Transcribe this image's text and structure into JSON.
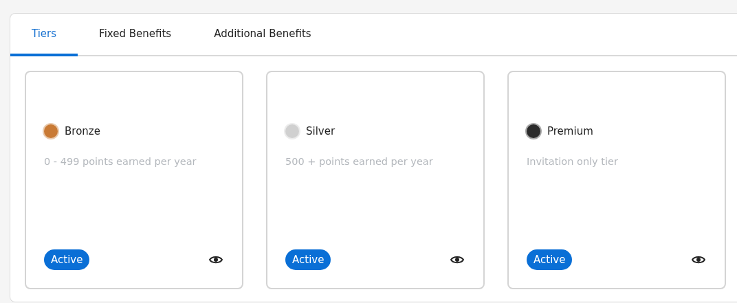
{
  "tabs": [
    {
      "label": "Tiers",
      "selected": true
    },
    {
      "label": "Fixed Benefits",
      "selected": false
    },
    {
      "label": "Additional Benefits",
      "selected": false
    }
  ],
  "tiers": [
    {
      "name": "Bronze",
      "color": "#c97a35",
      "description": "0 - 499 points earned per year",
      "status": "Active"
    },
    {
      "name": "Silver",
      "color": "#d0d0d0",
      "description": "500 + points earned per year",
      "status": "Active"
    },
    {
      "name": "Premium",
      "color": "#2b2b2b",
      "description": "Invitation only tier",
      "status": "Active"
    }
  ]
}
